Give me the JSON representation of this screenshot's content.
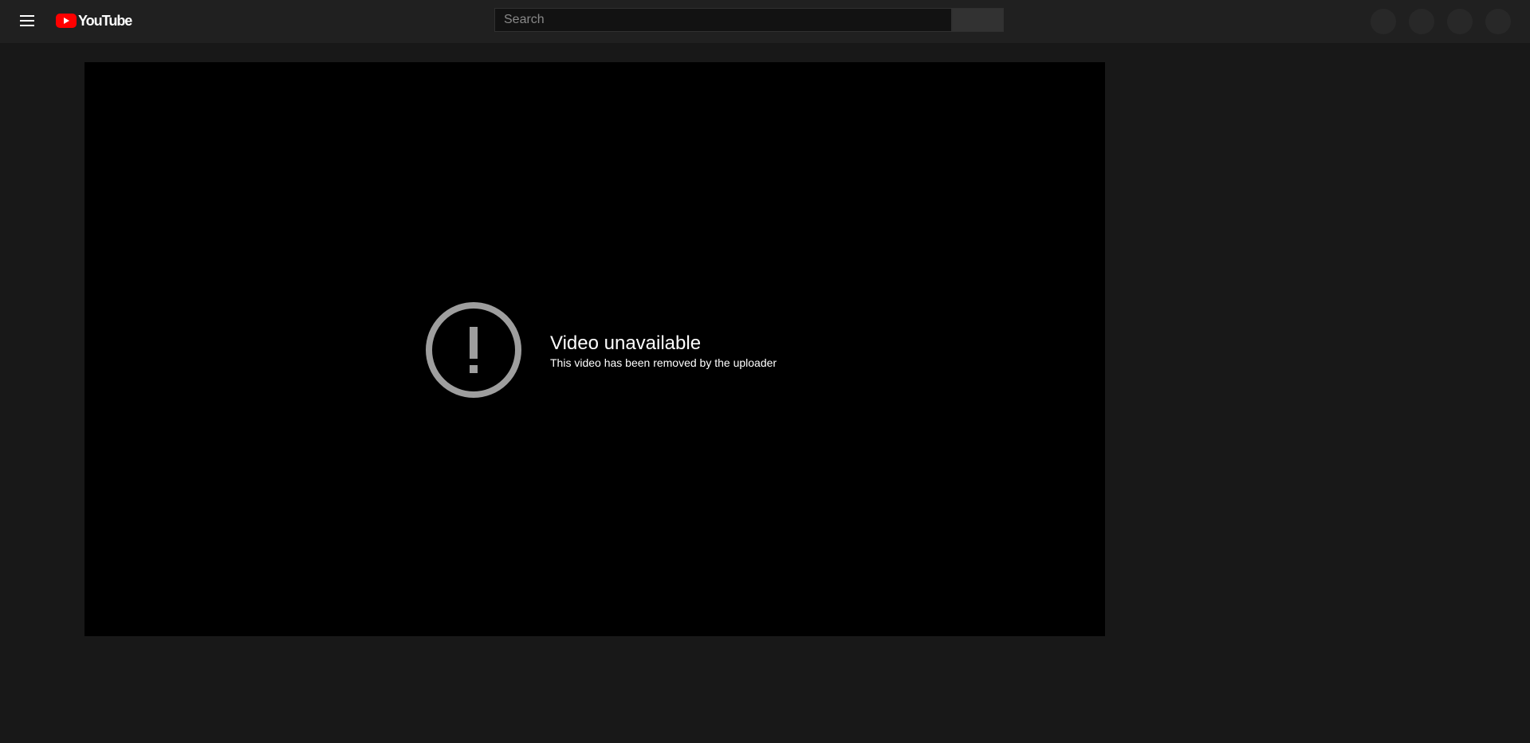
{
  "header": {
    "logo_text": "YouTube",
    "search": {
      "placeholder": "Search",
      "value": ""
    },
    "icons": {
      "menu": "hamburger-menu-icon",
      "logo": "youtube-logo-icon"
    }
  },
  "player": {
    "error_icon": "alert-circle-icon",
    "error_title": "Video unavailable",
    "error_subtitle": "This video has been removed by the uploader"
  },
  "colors": {
    "page_background": "#181818",
    "header_background": "#202020",
    "player_background": "#000000",
    "brand_red": "#ff0000",
    "error_icon_color": "#9e9e9e"
  }
}
